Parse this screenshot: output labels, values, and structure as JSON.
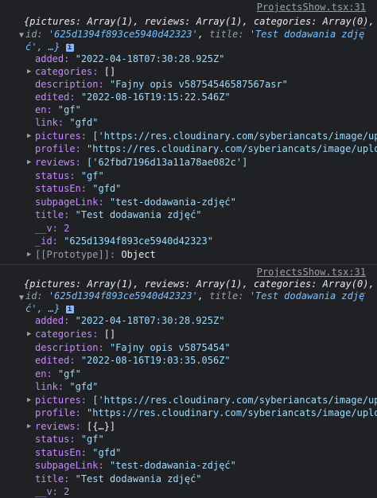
{
  "entries": [
    {
      "source": "ProjectsShow.tsx:31",
      "summary_line1": "{pictures: Array(1), reviews: Array(1), categories: Array(0),",
      "summary_id_key": "id:",
      "summary_id_val": "'625d1394f893ce5940d42323'",
      "summary_title_key": "title:",
      "summary_title_val": "'Test dodawania zdję",
      "summary_line2": "ć', …}",
      "info_icon": "i",
      "fields": {
        "added": "\"2022-04-18T07:30:28.925Z\"",
        "categories": "[]",
        "description": "\"Fajny opis v58754546587567asr\"",
        "edited": "\"2022-08-16T19:15:22.546Z\"",
        "en": "\"gf\"",
        "link": "\"gfd\"",
        "pictures": "['https://res.cloudinary.com/syberiancats/image/uplo",
        "profile": "\"https://res.cloudinary.com/syberiancats/image/upload",
        "reviews": "['62fbd7196d13a11a78ae082c']",
        "status": "\"gf\"",
        "statusEn": "\"gfd\"",
        "subpageLink": "\"test-dodawania-zdjęć\"",
        "title": "\"Test dodawania zdjęć\"",
        "v": "2",
        "_id": "\"625d1394f893ce5940d42323\"",
        "prototype": "Object"
      }
    },
    {
      "source": "ProjectsShow.tsx:31",
      "summary_line1": "{pictures: Array(1), reviews: Array(1), categories: Array(0),",
      "summary_id_key": "id:",
      "summary_id_val": "'625d1394f893ce5940d42323'",
      "summary_title_key": "title:",
      "summary_title_val": "'Test dodawania zdję",
      "summary_line2": "ć', …}",
      "info_icon": "i",
      "fields": {
        "added": "\"2022-04-18T07:30:28.925Z\"",
        "categories": "[]",
        "description": "\"Fajny opis v5875454\"",
        "edited": "\"2022-08-16T19:03:35.056Z\"",
        "en": "\"gf\"",
        "link": "\"gfd\"",
        "pictures": "['https://res.cloudinary.com/syberiancats/image/uplo",
        "profile": "\"https://res.cloudinary.com/syberiancats/image/upload",
        "reviews": "[{…}]",
        "status": "\"gf\"",
        "statusEn": "\"gfd\"",
        "subpageLink": "\"test-dodawania-zdjęć\"",
        "title": "\"Test dodawania zdjęć\"",
        "v": "2"
      }
    }
  ],
  "labels": {
    "added": "added:",
    "categories": "categories:",
    "description": "description:",
    "edited": "edited:",
    "en": "en:",
    "link": "link:",
    "pictures": "pictures:",
    "profile": "profile:",
    "reviews": "reviews:",
    "status": "status:",
    "statusEn": "statusEn:",
    "subpageLink": "subpageLink:",
    "title": "title:",
    "v": "__v:",
    "_id": "_id:",
    "prototype": "[[Prototype]]:"
  },
  "collapse_dash": "_"
}
